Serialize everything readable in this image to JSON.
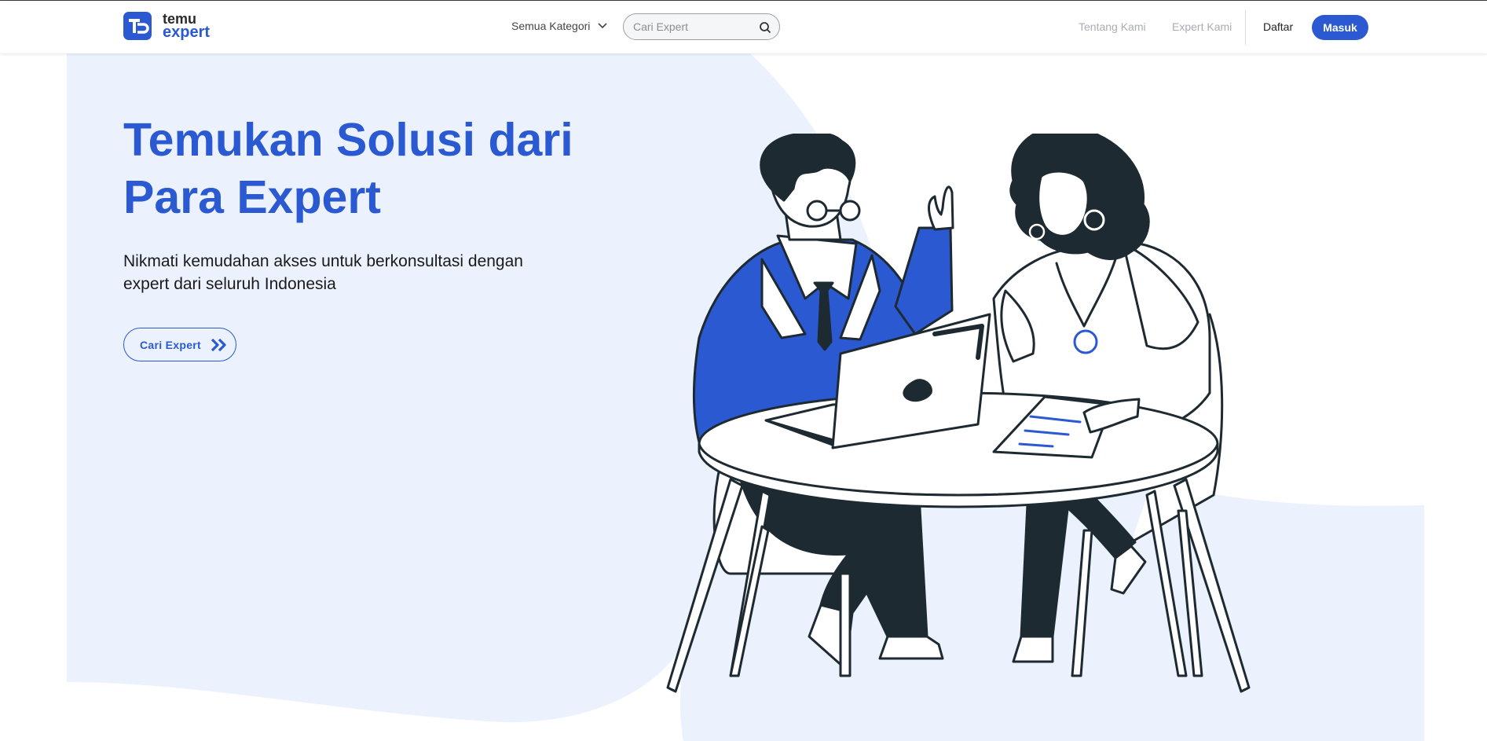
{
  "brand": {
    "logo_line1": "temu",
    "logo_line2": "expert",
    "primary_color": "#2b59d1",
    "hero_bg_color": "#ebf2fd"
  },
  "navbar": {
    "category_select": "Semua Kategori",
    "search_placeholder": "Cari Expert",
    "links": [
      "Tentang Kami",
      "Expert Kami"
    ],
    "register_label": "Daftar",
    "login_label": "Masuk"
  },
  "hero": {
    "title_line1": "Temukan Solusi dari",
    "title_line2": "Para Expert",
    "subtitle_line1": "Nikmati kemudahan akses untuk berkonsultasi dengan",
    "subtitle_line2": "expert dari seluruh Indonesia",
    "cta_label": "Cari Expert",
    "illustration": "two-people-consulting-at-table"
  }
}
